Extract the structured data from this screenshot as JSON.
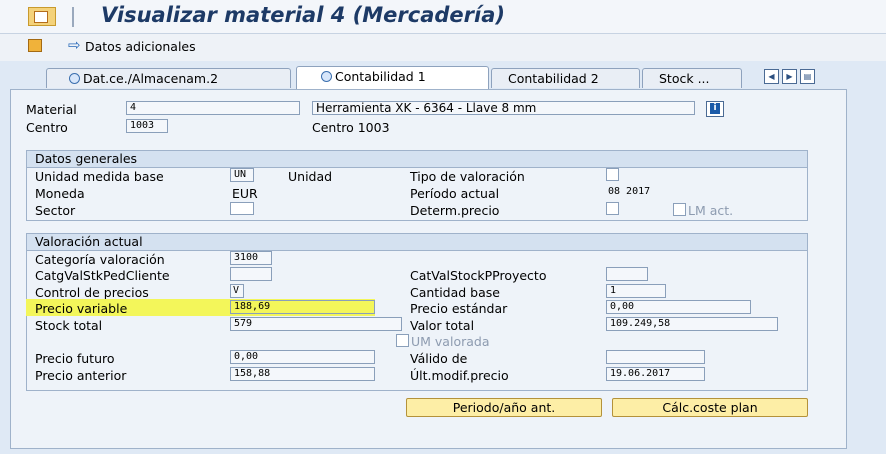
{
  "window": {
    "title": "Visualizar material 4 (Mercadería)"
  },
  "toolbar": {
    "additional_data_label": "Datos adicionales"
  },
  "tabs": [
    {
      "label": "Dat.ce./Almacenam.2",
      "active": false
    },
    {
      "label": "Contabilidad 1",
      "active": true
    },
    {
      "label": "Contabilidad 2",
      "active": false
    },
    {
      "label": "Stock ...",
      "active": false
    }
  ],
  "header": {
    "material_label": "Material",
    "material_value": "4",
    "material_desc": "Herramienta XK - 6364 - Llave 8 mm",
    "centro_label": "Centro",
    "centro_value": "1003",
    "centro_desc": "Centro 1003",
    "info_icon": "i"
  },
  "datos_generales": {
    "title": "Datos generales",
    "unidad_label": "Unidad medida base",
    "unidad_value": "UN",
    "unidad_text": "Unidad",
    "tipo_val_label": "Tipo de valoración",
    "moneda_label": "Moneda",
    "moneda_value": "EUR",
    "periodo_label": "Período actual",
    "periodo_value": "08 2017",
    "sector_label": "Sector",
    "determ_label": "Determ.precio",
    "lm_act_label": "LM act."
  },
  "valoracion": {
    "title": "Valoración actual",
    "categoria_label": "Categoría valoración",
    "categoria_value": "3100",
    "catg_ped_label": "CatgValStkPedCliente",
    "cat_proy_label": "CatValStockPProyecto",
    "control_label": "Control de precios",
    "control_value": "V",
    "cantidad_label": "Cantidad base",
    "cantidad_value": "1",
    "precio_var_label": "Precio variable",
    "precio_var_value": "188,69",
    "precio_est_label": "Precio estándar",
    "precio_est_value": "0,00",
    "stock_label": "Stock total",
    "stock_value": "579",
    "valor_label": "Valor total",
    "valor_value": "109.249,58",
    "um_valorada_label": "UM valorada",
    "precio_fut_label": "Precio futuro",
    "precio_fut_value": "0,00",
    "valido_label": "Válido de",
    "precio_ant_label": "Precio anterior",
    "precio_ant_value": "158,88",
    "ult_modif_label": "Últ.modif.precio",
    "ult_modif_value": "19.06.2017"
  },
  "buttons": {
    "periodo_ant": "Periodo/año ant.",
    "calc_coste": "Cálc.coste plan"
  },
  "colors": {
    "highlight": "#f3f65a",
    "title": "#1d3a66",
    "button": "#fdeea6"
  }
}
